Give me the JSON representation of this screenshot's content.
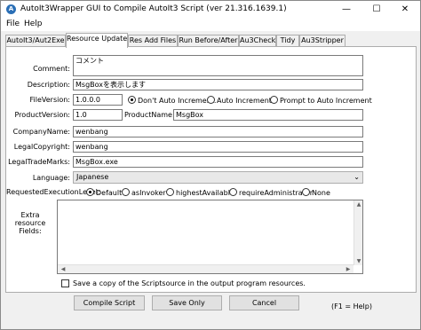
{
  "window": {
    "title": "AutoIt3Wrapper GUI to Compile AutoIt3 Script (ver 21.316.1639.1)",
    "minimize": "—",
    "maximize": "☐",
    "close": "✕"
  },
  "menu": [
    "File",
    "Help"
  ],
  "tabs": [
    "AutoIt3/Aut2Exe",
    "Resource Update",
    "Res Add Files",
    "Run Before/After",
    "Au3Check",
    "Tidy",
    "Au3Stripper"
  ],
  "active_tab": "Resource Update",
  "form": {
    "comment_label": "Comment:",
    "comment_value": "コメント",
    "description_label": "Description:",
    "description_value": "MsgBoxを表示します",
    "fileversion_label": "FileVersion:",
    "fileversion_value": "1.0.0.0",
    "version_options": [
      "Don't Auto Increment.",
      "Auto Increment",
      "Prompt to Auto Increment"
    ],
    "version_selected": "Don't Auto Increment.",
    "productversion_label": "ProductVersion:",
    "productversion_value": "1.0",
    "productname_label": "ProductName:",
    "productname_value": "MsgBox",
    "companyname_label": "CompanyName:",
    "companyname_value": "wenbang",
    "legalcopyright_label": "LegalCopyright:",
    "legalcopyright_value": "wenbang",
    "legaltrademarks_label": "LegalTradeMarks:",
    "legaltrademarks_value": "MsgBox.exe",
    "language_label": "Language:",
    "language_value": "Japanese",
    "execlevel_label": "RequestedExecutionLevel:",
    "execlevel_options": [
      "Default",
      "asInvoker",
      "highestAvailable",
      "requireAdministrator",
      "None"
    ],
    "execlevel_selected": "Default",
    "extra_label_1": "Extra",
    "extra_label_2": "resource",
    "extra_label_3": "Fields:",
    "save_copy_label": "Save a copy of the Scriptsource in the output program resources."
  },
  "buttons": {
    "compile": "Compile Script",
    "save_only": "Save Only",
    "cancel": "Cancel"
  },
  "help_hint": "(F1 = Help)",
  "icons": {
    "app": "autoit-icon",
    "dropdown": "chevron-down-icon"
  }
}
